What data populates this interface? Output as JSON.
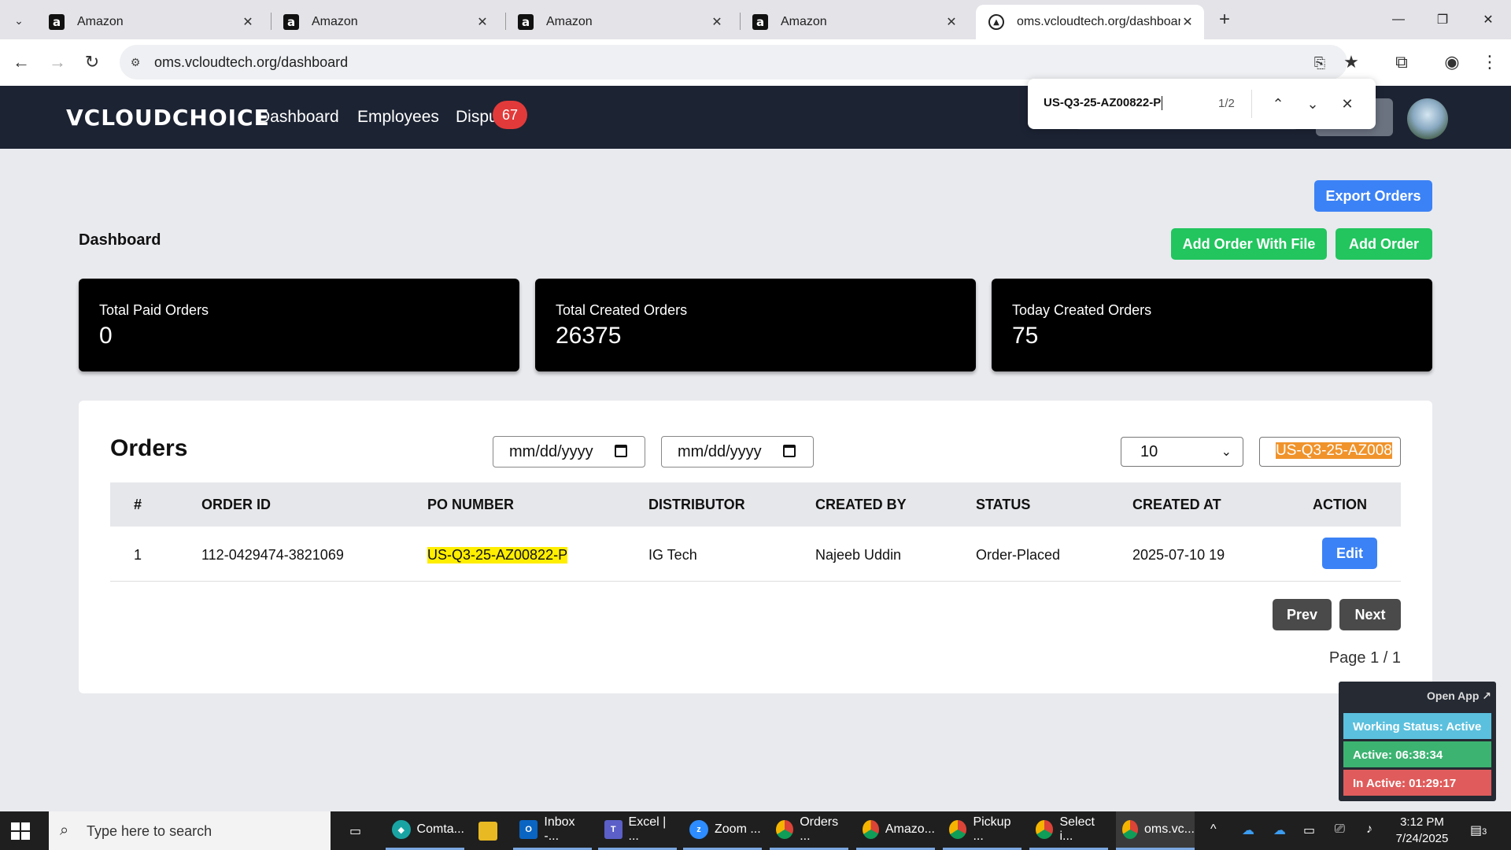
{
  "browser": {
    "tabs": [
      {
        "title": "Amazon"
      },
      {
        "title": "Amazon"
      },
      {
        "title": "Amazon"
      },
      {
        "title": "Amazon"
      },
      {
        "title": "oms.vcloudtech.org/dashboard"
      }
    ],
    "url": "oms.vcloudtech.org/dashboard"
  },
  "find": {
    "query": "US-Q3-25-AZ00822-P",
    "count": "1/2"
  },
  "app": {
    "logo": "VCLOUDCHOICE",
    "nav": {
      "dashboard": "Dashboard",
      "employees": "Employees",
      "disputes": "Dispu"
    },
    "badge": "67"
  },
  "dashboard": {
    "title": "Dashboard",
    "export_label": "Export Orders",
    "add_file_label": "Add Order With File",
    "add_label": "Add Order",
    "stats": [
      {
        "label": "Total Paid Orders",
        "value": "0"
      },
      {
        "label": "Total Created Orders",
        "value": "26375"
      },
      {
        "label": "Today Created Orders",
        "value": "75"
      }
    ]
  },
  "orders": {
    "title": "Orders",
    "date_from_placeholder": "mm/dd/yyyy",
    "date_to_placeholder": "mm/dd/yyyy",
    "page_size": "10",
    "search_value": "US-Q3-25-AZ008",
    "columns": [
      "#",
      "ORDER ID",
      "PO NUMBER",
      "DISTRIBUTOR",
      "CREATED BY",
      "STATUS",
      "CREATED AT",
      "ACTION"
    ],
    "rows": [
      {
        "num": "1",
        "order_id": "112-0429474-3821069",
        "po": "US-Q3-25-AZ00822-P",
        "distributor": "IG Tech",
        "created_by": "Najeeb Uddin",
        "status": "Order-Placed",
        "created_at": "2025-07-10 19",
        "action": "Edit"
      }
    ],
    "prev_label": "Prev",
    "next_label": "Next",
    "page_info": "Page 1 / 1"
  },
  "tracker": {
    "open_label": "Open App ↗",
    "working": "Working Status: Active",
    "active": "Active: 06:38:34",
    "inactive": "In Active: 01:29:17",
    "colors": {
      "working": "#5bc0de",
      "active": "#3cb371",
      "inactive": "#e05c5c"
    }
  },
  "taskbar": {
    "search_placeholder": "Type here to search",
    "apps": [
      {
        "label": "Comta...",
        "icon": "comta-icon"
      },
      {
        "label": "",
        "icon": "folder-icon"
      },
      {
        "label": "Inbox -...",
        "icon": "outlook-icon"
      },
      {
        "label": "Excel | ...",
        "icon": "teams-icon"
      },
      {
        "label": "Zoom ...",
        "icon": "zoom-icon"
      },
      {
        "label": "Orders ...",
        "icon": "chrome-icon"
      },
      {
        "label": "Amazo...",
        "icon": "chrome-icon"
      },
      {
        "label": "Pickup ...",
        "icon": "chrome-icon"
      },
      {
        "label": "Select i...",
        "icon": "chrome-icon"
      },
      {
        "label": "oms.vc...",
        "icon": "chrome-icon"
      }
    ],
    "time": "3:12 PM",
    "date": "7/24/2025",
    "notifications": "3"
  }
}
